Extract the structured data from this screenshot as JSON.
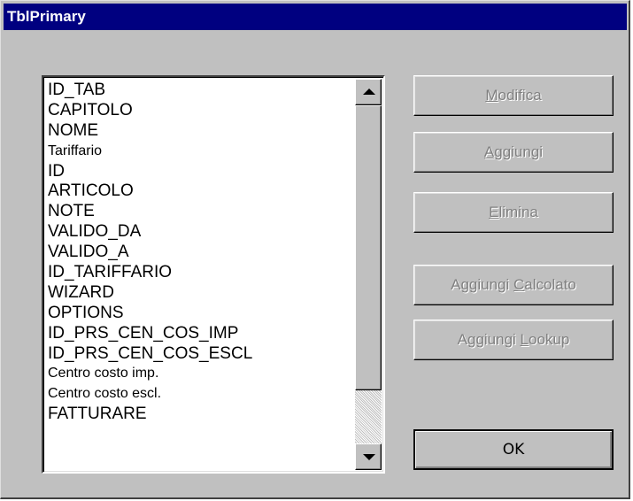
{
  "window": {
    "title": "TblPrimary"
  },
  "fields": [
    "ID_TAB",
    "CAPITOLO",
    "NOME",
    "Tariffario",
    "ID",
    "ARTICOLO",
    "NOTE",
    "VALIDO_DA",
    "VALIDO_A",
    "ID_TARIFFARIO",
    "WIZARD",
    "OPTIONS",
    "ID_PRS_CEN_COS_IMP",
    "ID_PRS_CEN_COS_ESCL",
    "Centro costo imp.",
    "Centro costo escl.",
    "FATTURARE"
  ],
  "buttons": {
    "modifica": {
      "pre": "",
      "key": "M",
      "post": "odifica",
      "enabled": false
    },
    "aggiungi": {
      "pre": "",
      "key": "A",
      "post": "ggiungi",
      "enabled": false
    },
    "elimina": {
      "pre": "",
      "key": "E",
      "post": "limina",
      "enabled": false
    },
    "aggiungi_calcolato": {
      "pre": "Aggiungi ",
      "key": "C",
      "post": "alcolato",
      "enabled": false
    },
    "aggiungi_lookup": {
      "pre": "Aggiungi ",
      "key": "L",
      "post": "ookup",
      "enabled": false
    },
    "ok": {
      "label": "OK",
      "enabled": true
    }
  },
  "scrollbar": {
    "position": 0
  },
  "colors": {
    "titlebar": "#000080",
    "face": "#c0c0c0",
    "disabled_text": "#808080"
  }
}
